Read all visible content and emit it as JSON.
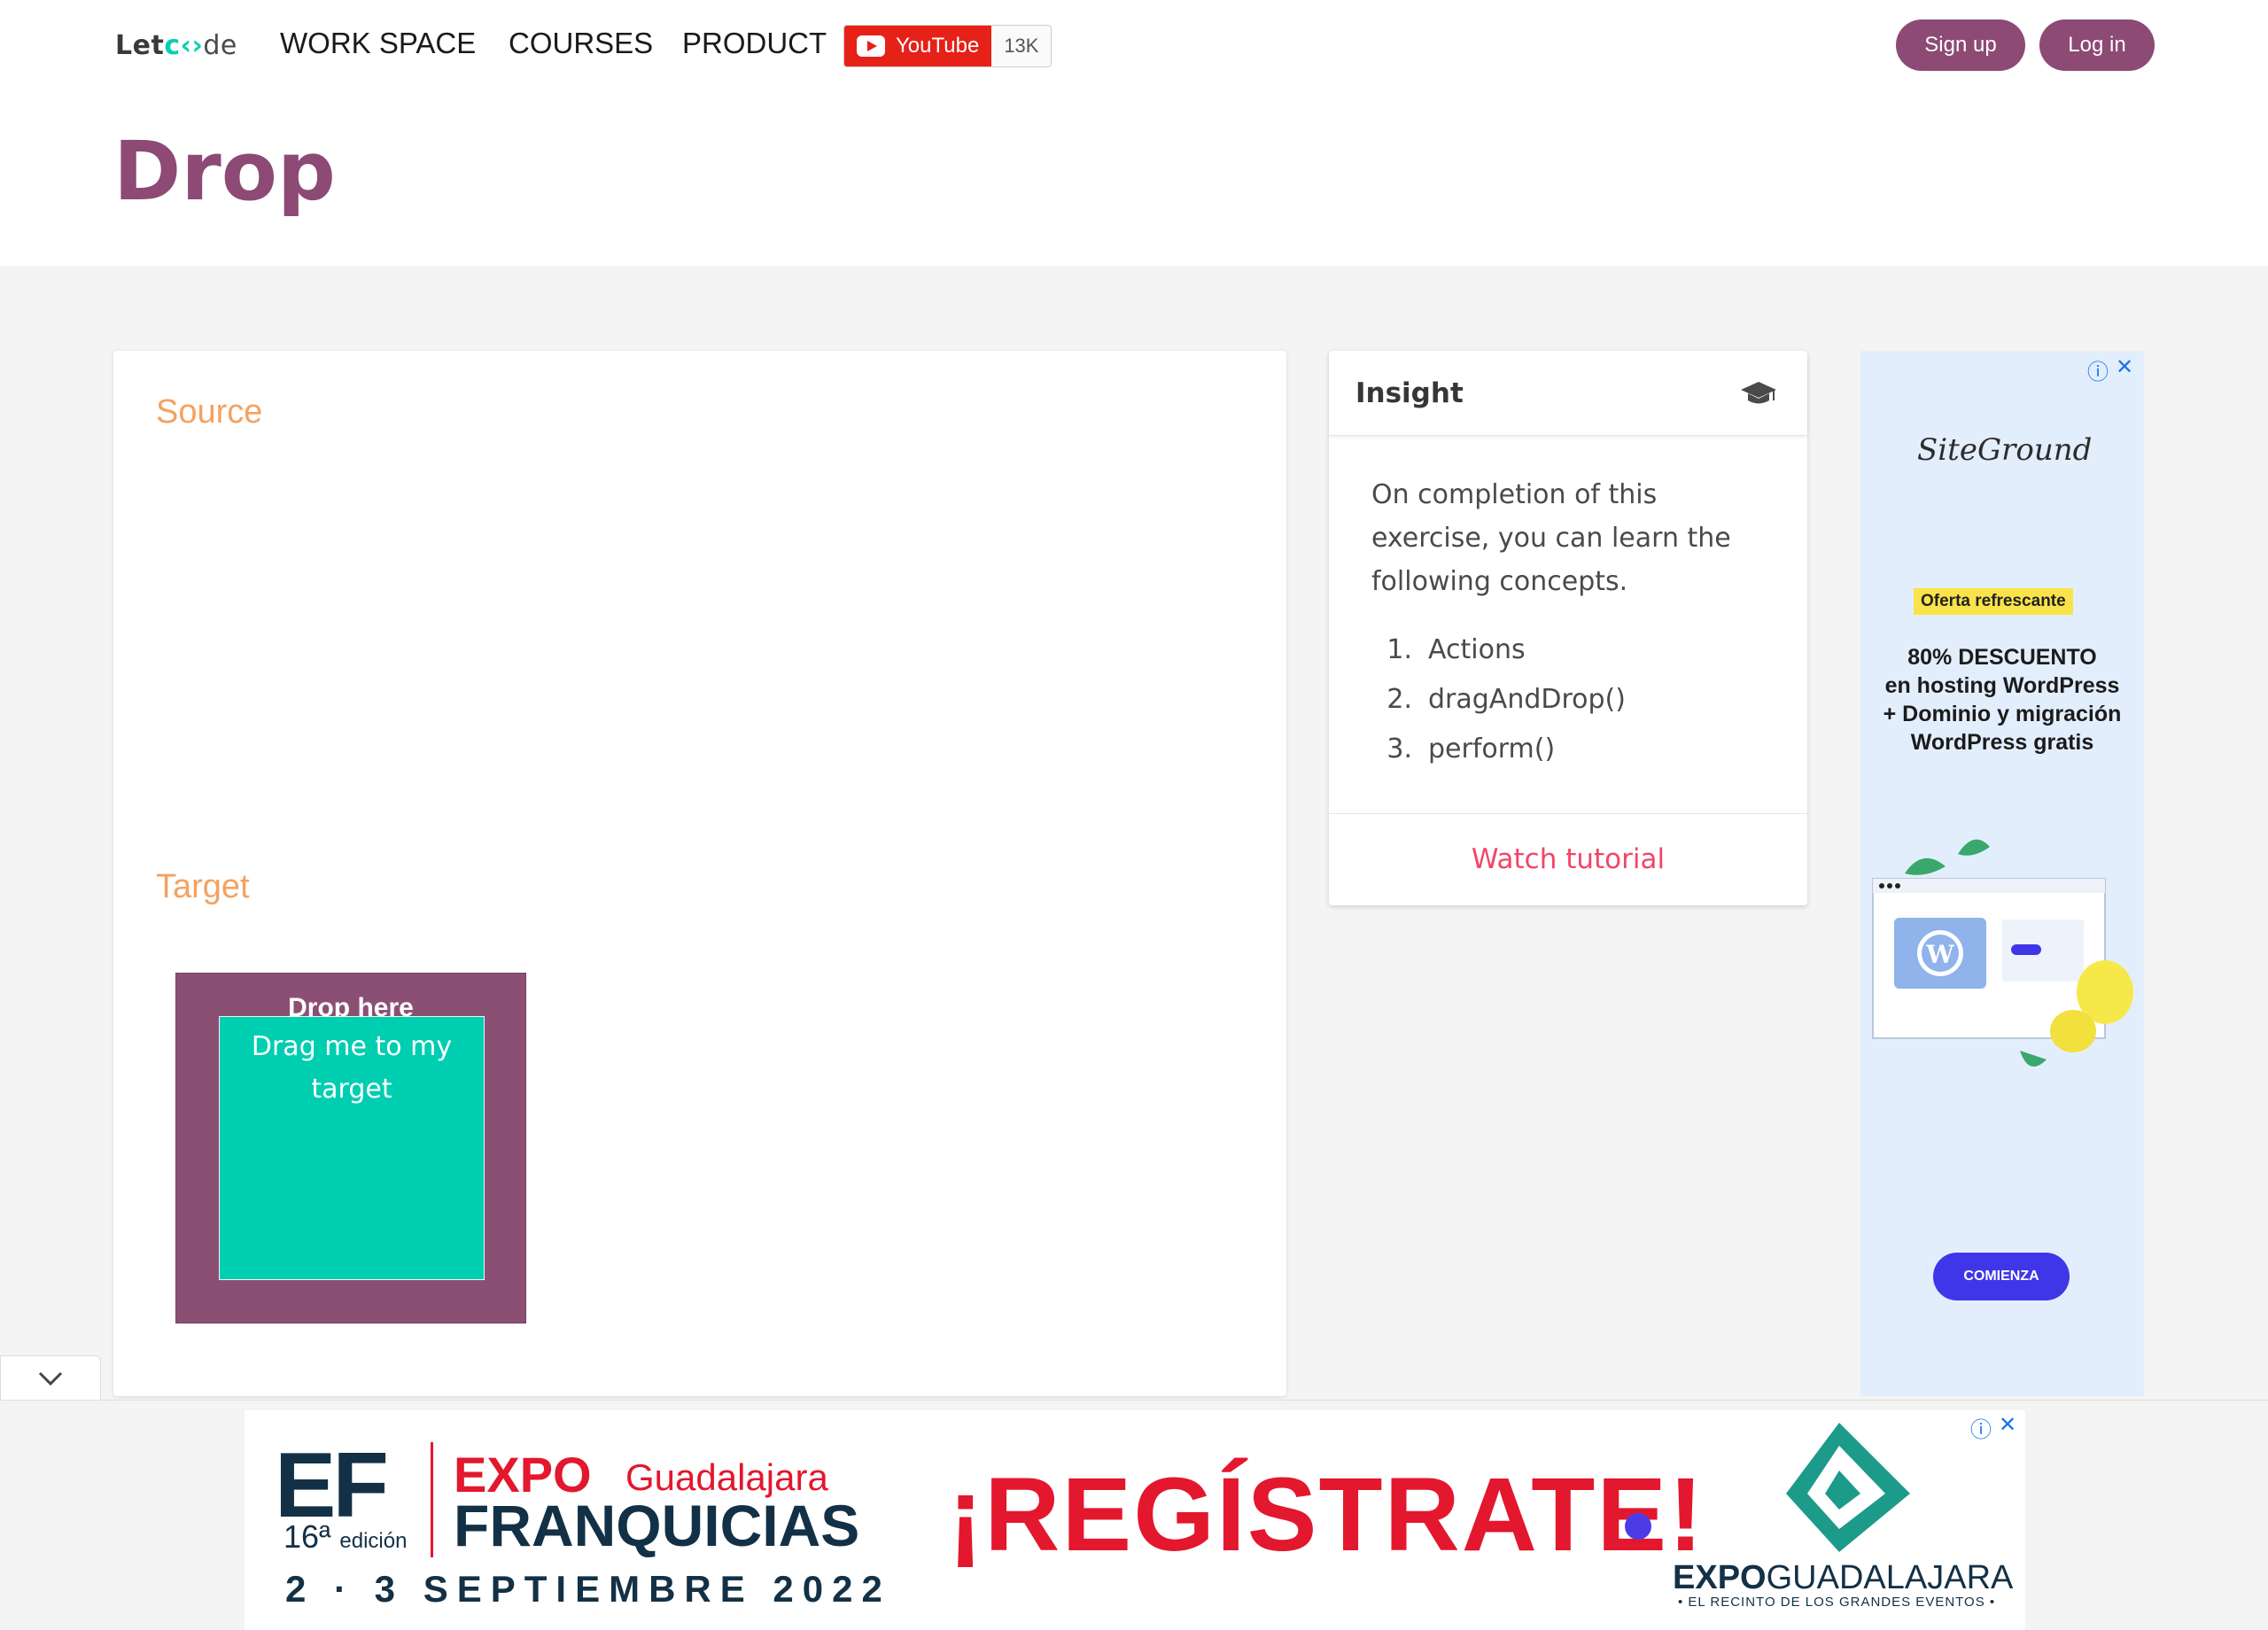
{
  "nav": {
    "logo_prefix": "Let",
    "logo_glyph": "c‹›",
    "logo_suffix": "de",
    "links": [
      "WORK SPACE",
      "COURSES",
      "PRODUCT"
    ],
    "youtube_label": "YouTube",
    "youtube_count": "13K",
    "signup": "Sign up",
    "login": "Log in"
  },
  "page": {
    "title": "Drop"
  },
  "workspace": {
    "source_label": "Source",
    "target_label": "Target",
    "drop_label": "Drop here",
    "drag_label": "Drag me to my target"
  },
  "insight": {
    "title": "Insight",
    "intro": "On completion of this exercise, you can learn the following concepts.",
    "items": [
      {
        "num": "1.",
        "text": "Actions"
      },
      {
        "num": "2.",
        "text": "dragAndDrop()"
      },
      {
        "num": "3.",
        "text": "perform()"
      }
    ],
    "footer_link": "Watch tutorial"
  },
  "ad_right": {
    "brand": "SiteGround",
    "badge": "Oferta refrescante",
    "line1": "80% DESCUENTO",
    "line2": "en hosting WordPress",
    "line3": "+ Dominio y migración",
    "line4": "WordPress gratis",
    "cta": "COMIENZA"
  },
  "ad_bottom": {
    "ef": "EF",
    "edition_num": "16ª",
    "edition_word": "edición",
    "expo": "EXPO",
    "city": "Guadalajara",
    "franquicias": "FRANQUICIAS",
    "date": "2 · 3 SEPTIEMBRE 2022",
    "register": "¡REGÍSTRATE!",
    "venue_bold": "EXPO",
    "venue_light": "GUADALAJARA",
    "venue_tagline": "• EL RECINTO DE LOS GRANDES EVENTOS •"
  },
  "icons": {
    "graduation": "graduation-cap-icon",
    "info": "info-icon",
    "close": "close-icon",
    "collapse": "chevron-down-icon"
  },
  "colors": {
    "brand": "#8c4a74",
    "accent_orange": "#f4a261",
    "teal": "#00ceb0",
    "link_red": "#f14668",
    "youtube_red": "#e62117"
  }
}
